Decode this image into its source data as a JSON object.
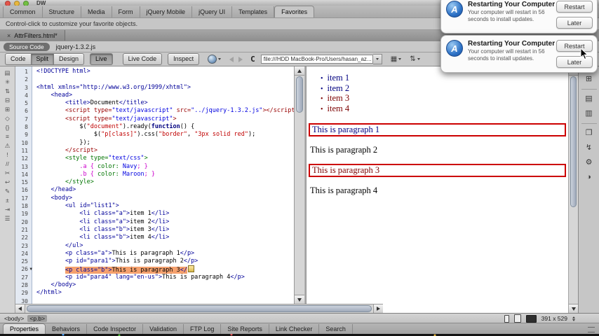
{
  "window": {
    "app_label": "DW"
  },
  "insert_bar": {
    "tabs": [
      "Common",
      "Structure",
      "Media",
      "Form",
      "jQuery Mobile",
      "jQuery UI",
      "Templates",
      "Favorites"
    ],
    "active_tab": "Favorites",
    "tip": "Control-click to customize your favorite objects."
  },
  "document_tab": {
    "close_glyph": "×",
    "filename": "AttrFilters.html*"
  },
  "related_files": {
    "source_code_label": "Source Code",
    "file_label": "jquery-1.3.2.js"
  },
  "toolbar": {
    "code": "Code",
    "split": "Split",
    "design": "Design",
    "live": "Live",
    "live_code": "Live Code",
    "inspect": "Inspect",
    "refresh_glyph": "C",
    "address": "file:///HDD MacBook-Pro/Users/hasan_az..."
  },
  "code_editor": {
    "selected_line": 26,
    "collapse_arrow_glyph": "▼",
    "lines": [
      [
        [
          "<!DOCTYPE html>",
          "t"
        ]
      ],
      [],
      [
        [
          "<html xmlns=\"http://www.w3.org/1999/xhtml\">",
          "t"
        ]
      ],
      [
        [
          "    <head>",
          "t"
        ]
      ],
      [
        [
          "        ",
          "x"
        ],
        [
          "<title>",
          "t"
        ],
        [
          "Document",
          "x"
        ],
        [
          "</title>",
          "t"
        ]
      ],
      [
        [
          "        ",
          "x"
        ],
        [
          "<script type=",
          "s"
        ],
        [
          "\"text/javascript\"",
          "v"
        ],
        [
          " src=",
          "s"
        ],
        [
          "\"../jquery-1.3.2.js\"",
          "v"
        ],
        [
          "></script>",
          "s"
        ]
      ],
      [
        [
          "        ",
          "x"
        ],
        [
          "<script type=",
          "s"
        ],
        [
          "\"text/javascript\"",
          "v"
        ],
        [
          ">",
          "s"
        ]
      ],
      [
        [
          "            $(",
          "x"
        ],
        [
          "\"document\"",
          "str"
        ],
        [
          ").ready(",
          "x"
        ],
        [
          "function",
          "kw"
        ],
        [
          "() {",
          "x"
        ]
      ],
      [
        [
          "                $(",
          "x"
        ],
        [
          "\"p[class]\"",
          "str"
        ],
        [
          ").css(",
          "x"
        ],
        [
          "\"border\"",
          "str"
        ],
        [
          ", ",
          "x"
        ],
        [
          "\"3px solid red\"",
          "str"
        ],
        [
          ");",
          "x"
        ]
      ],
      [
        [
          "            });",
          "x"
        ]
      ],
      [
        [
          "        ",
          "x"
        ],
        [
          "</script>",
          "s"
        ]
      ],
      [
        [
          "        ",
          "x"
        ],
        [
          "<style type=",
          "c"
        ],
        [
          "\"text/css\"",
          "v"
        ],
        [
          ">",
          "c"
        ]
      ],
      [
        [
          "            ",
          "x"
        ],
        [
          ".a { ",
          "sel"
        ],
        [
          "color:",
          "prop"
        ],
        [
          " ",
          "x"
        ],
        [
          "Navy",
          "val"
        ],
        [
          "; }",
          "sel"
        ]
      ],
      [
        [
          "            ",
          "x"
        ],
        [
          ".b { ",
          "sel"
        ],
        [
          "color:",
          "prop"
        ],
        [
          " ",
          "x"
        ],
        [
          "Maroon",
          "val"
        ],
        [
          "; }",
          "sel"
        ]
      ],
      [
        [
          "        ",
          "x"
        ],
        [
          "</style>",
          "c"
        ]
      ],
      [
        [
          "    </head>",
          "t"
        ]
      ],
      [
        [
          "    <body>",
          "t"
        ]
      ],
      [
        [
          "        <ul id=\"list1\">",
          "t"
        ]
      ],
      [
        [
          "            <li class=\"a\">",
          "t"
        ],
        [
          "item 1",
          "x"
        ],
        [
          "</li>",
          "t"
        ]
      ],
      [
        [
          "            <li class=\"a\">",
          "t"
        ],
        [
          "item 2",
          "x"
        ],
        [
          "</li>",
          "t"
        ]
      ],
      [
        [
          "            <li class=\"b\">",
          "t"
        ],
        [
          "item 3",
          "x"
        ],
        [
          "</li>",
          "t"
        ]
      ],
      [
        [
          "            <li class=\"b\">",
          "t"
        ],
        [
          "item 4",
          "x"
        ],
        [
          "</li>",
          "t"
        ]
      ],
      [
        [
          "        </ul>",
          "t"
        ]
      ],
      [
        [
          "        <p class=\"a\">",
          "t"
        ],
        [
          "This is paragraph 1",
          "x"
        ],
        [
          "</p>",
          "t"
        ]
      ],
      [
        [
          "        <p id=\"para1\">",
          "t"
        ],
        [
          "This is paragraph 2",
          "x"
        ],
        [
          "</p>",
          "t"
        ]
      ],
      {
        "segs": [
          [
            "        ",
            "x"
          ],
          [
            "<p class=\"b\">",
            "t",
            1
          ],
          [
            "This is paragraph 3",
            "x",
            1
          ],
          [
            "</",
            "t",
            1
          ]
        ],
        "marker": true
      },
      [
        [
          "        <p id=\"para4\" lang=\"en-us\">",
          "t"
        ],
        [
          "This is paragraph 4",
          "x"
        ],
        [
          "</p>",
          "t"
        ]
      ],
      [
        [
          "    </body>",
          "t"
        ]
      ],
      [
        [
          "</html>",
          "t"
        ]
      ],
      []
    ]
  },
  "design_view": {
    "bullet_glyph": "•",
    "class_colors": {
      "a": "#000080",
      "b": "#7c0000",
      "none": "#000000"
    },
    "list_items": [
      {
        "text": "item 1",
        "cls": "a"
      },
      {
        "text": "item 2",
        "cls": "a"
      },
      {
        "text": "item 3",
        "cls": "b"
      },
      {
        "text": "item 4",
        "cls": "b"
      }
    ],
    "paragraphs": [
      {
        "text": "This is paragraph 1",
        "cls": "a",
        "bordered": true
      },
      {
        "text": "This is paragraph 2",
        "cls": "none",
        "bordered": false
      },
      {
        "text": "This is paragraph 3",
        "cls": "b",
        "bordered": true
      },
      {
        "text": "This is paragraph 4",
        "cls": "none",
        "bordered": false
      }
    ],
    "border_color": "#cc0000"
  },
  "status_bar": {
    "tag1": "<body>",
    "tag2": "<p.b>",
    "dimensions": "391 x 529"
  },
  "properties_bar": {
    "tabs": [
      "Properties",
      "Behaviors",
      "Code Inspector",
      "Validation",
      "FTP Log",
      "Site Reports",
      "Link Checker",
      "Search"
    ],
    "active_tab": "Properties"
  },
  "coding_toolbar_icons": [
    {
      "name": "open-documents-icon",
      "glyph": "▤"
    },
    {
      "name": "code-navigator-icon",
      "glyph": "✳"
    },
    {
      "name": "collapse-full-tag-icon",
      "glyph": "⇅"
    },
    {
      "name": "collapse-selection-icon",
      "glyph": "⊟"
    },
    {
      "name": "expand-all-icon",
      "glyph": "⊞"
    },
    {
      "name": "select-parent-tag-icon",
      "glyph": "◇"
    },
    {
      "name": "balance-braces-icon",
      "glyph": "{}"
    },
    {
      "name": "line-numbers-icon",
      "glyph": "≡"
    },
    {
      "name": "highlight-invalid-code-icon",
      "glyph": "⚠"
    },
    {
      "name": "syntax-error-alerts-icon",
      "glyph": "!"
    },
    {
      "name": "apply-comment-icon",
      "glyph": "//"
    },
    {
      "name": "remove-comment-icon",
      "glyph": "✂"
    },
    {
      "name": "wrap-tag-icon",
      "glyph": "↩"
    },
    {
      "name": "recent-snippets-icon",
      "glyph": "✎"
    },
    {
      "name": "move-css-icon",
      "glyph": "±"
    },
    {
      "name": "indent-code-icon",
      "glyph": "⇥"
    },
    {
      "name": "format-source-icon",
      "glyph": "☰"
    }
  ],
  "dock_panel_icons": [
    {
      "name": "insert-panel-icon",
      "glyph": "⊞",
      "group_start": false
    },
    {
      "name": "css-styles-panel-icon",
      "glyph": "▤",
      "group_start": true
    },
    {
      "name": "ap-elements-panel-icon",
      "glyph": "▥",
      "group_start": false
    },
    {
      "name": "files-panel-icon",
      "glyph": "❐",
      "group_start": true
    },
    {
      "name": "behaviors-panel-icon",
      "glyph": "↯",
      "group_start": false
    },
    {
      "name": "assets-panel-icon",
      "glyph": "⚙",
      "group_start": false
    },
    {
      "name": "history-panel-icon",
      "glyph": "◑",
      "group_start": false
    }
  ],
  "notifications": {
    "cards": [
      {
        "title": "Restarting Your Computer",
        "line1": "Your computer will restart in 56",
        "line2": "seconds to install updates.",
        "icon_letter": "A",
        "restart_label": "Restart",
        "later_label": "Later"
      },
      {
        "title": "Restarting Your Computer",
        "line1": "Your computer will restart in 56",
        "line2": "seconds to install updates.",
        "icon_letter": "A",
        "restart_label": "Restart",
        "later_label": "Later"
      }
    ]
  }
}
